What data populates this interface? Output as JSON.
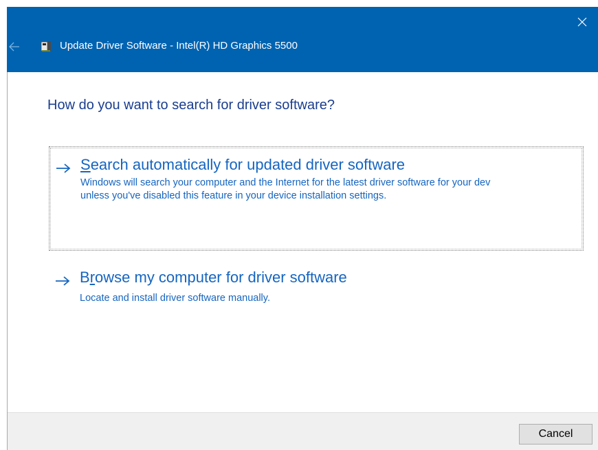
{
  "window": {
    "title": "Update Driver Software - Intel(R) HD Graphics 5500",
    "accent_color": "#0063b1"
  },
  "icons": {
    "back": "back-arrow-icon",
    "close": "close-icon",
    "device": "display-adapter-icon",
    "option_arrow": "right-arrow-icon"
  },
  "main": {
    "heading": "How do you want to search for driver software?",
    "options": [
      {
        "title_prefix": "",
        "title_key": "S",
        "title_rest": "earch automatically for updated driver software",
        "description": "Windows will search your computer and the Internet for the latest driver software for your dev\nunless you've disabled this feature in your device installation settings."
      },
      {
        "title_prefix": "B",
        "title_key": "r",
        "title_rest": "owse my computer for driver software",
        "description": "Locate and install driver software manually."
      }
    ]
  },
  "footer": {
    "cancel_label": "Cancel"
  }
}
